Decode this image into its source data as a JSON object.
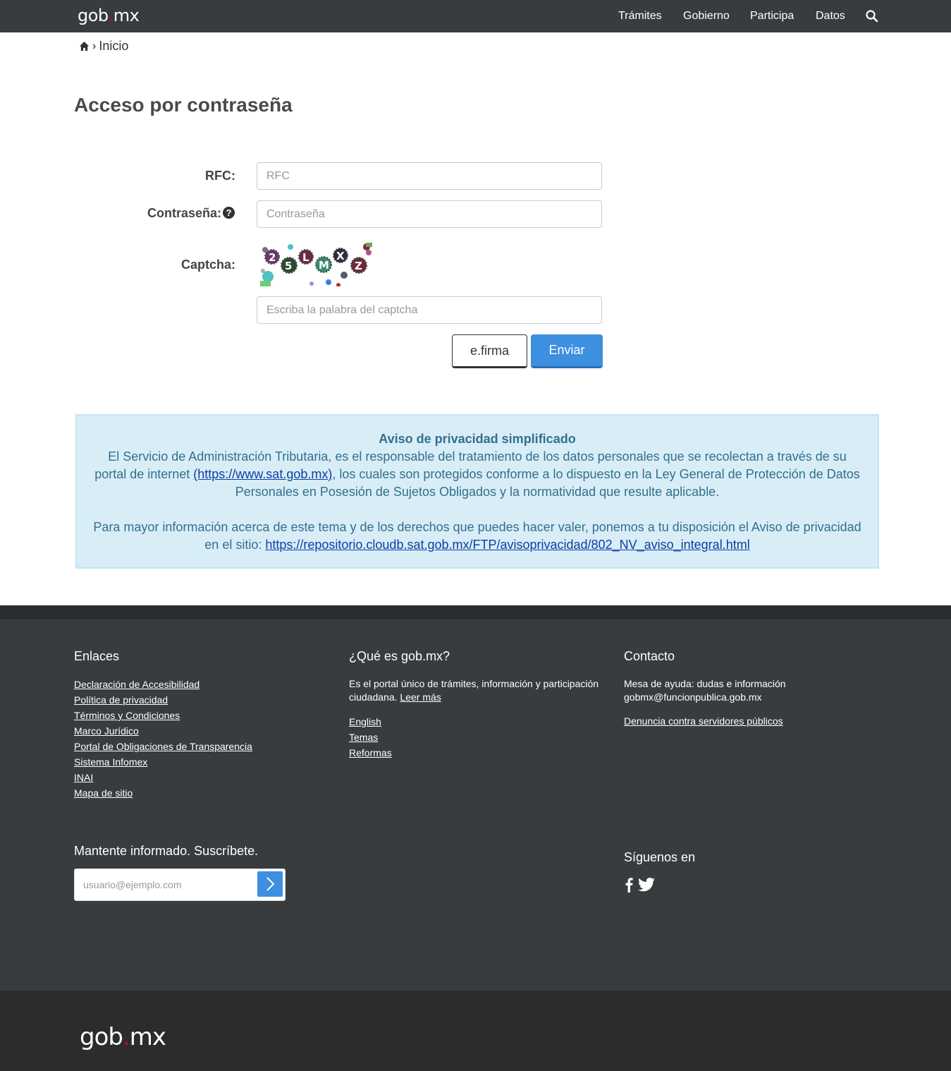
{
  "header": {
    "logo_left": "gob",
    "logo_dot": ".",
    "logo_right": "mx",
    "nav": [
      "Trámites",
      "Gobierno",
      "Participa",
      "Datos"
    ],
    "search_icon": "search-icon"
  },
  "breadcrumb": {
    "home_icon": "home-icon",
    "separator": "›",
    "current": "Inicio"
  },
  "page": {
    "title": "Acceso por contraseña"
  },
  "form": {
    "rfc_label": "RFC:",
    "rfc_placeholder": "RFC",
    "password_label": "Contraseña:",
    "help_icon": "?",
    "password_placeholder": "Contraseña",
    "captcha_label": "Captcha:",
    "captcha_chars": [
      "2",
      "5",
      "L",
      "M",
      "X",
      "Z"
    ],
    "captcha_placeholder": "Escriba la palabra del captcha",
    "efirma_label": "e.firma",
    "submit_label": "Enviar"
  },
  "notice": {
    "title": "Aviso de privacidad simplificado",
    "p1_before": "El Servicio de Administración Tributaria, es el responsable del tratamiento de los datos personales que se recolectan a través de su portal de internet ",
    "p1_link": "(https://www.sat.gob.mx)",
    "p1_after": ", los cuales son protegidos conforme a lo dispuesto en la Ley General de Protección de Datos Personales en Posesión de Sujetos Obligados y la normatividad que resulte aplicable.",
    "p2_before": "Para mayor información acerca de este tema y de los derechos que puedes hacer valer, ponemos a tu disposición el Aviso de privacidad en el sitio: ",
    "p2_link": "https://repositorio.cloudb.sat.gob.mx/FTP/avisoprivacidad/802_NV_aviso_integral.html"
  },
  "footer": {
    "enlaces_title": "Enlaces",
    "enlaces": [
      "Declaración de Accesibilidad",
      "Política de privacidad",
      "Términos y Condiciones",
      "Marco Jurídico",
      "Portal de Obligaciones de Transparencia",
      "Sistema Infomex",
      "INAI",
      "Mapa de sitio"
    ],
    "que_es_title": "¿Qué es gob.mx?",
    "que_es_text": "Es el portal único de trámites, información y participación ciudadana. ",
    "que_es_link": "Leer más",
    "que_es_links": [
      "English",
      "Temas",
      "Reformas"
    ],
    "contacto_title": "Contacto",
    "contacto_line1": "Mesa de ayuda: dudas e información",
    "contacto_line2": "gobmx@funcionpublica.gob.mx",
    "contacto_link": "Denuncia contra servidores públicos",
    "subscribe_title": "Mantente informado. Suscríbete.",
    "subscribe_placeholder": "usuario@ejemplo.com",
    "social_title": "Síguenos en",
    "social_icons": [
      "facebook-icon",
      "twitter-icon"
    ]
  },
  "bottom": {
    "logo_left": "gob",
    "logo_dot": ".",
    "logo_right": "mx"
  }
}
